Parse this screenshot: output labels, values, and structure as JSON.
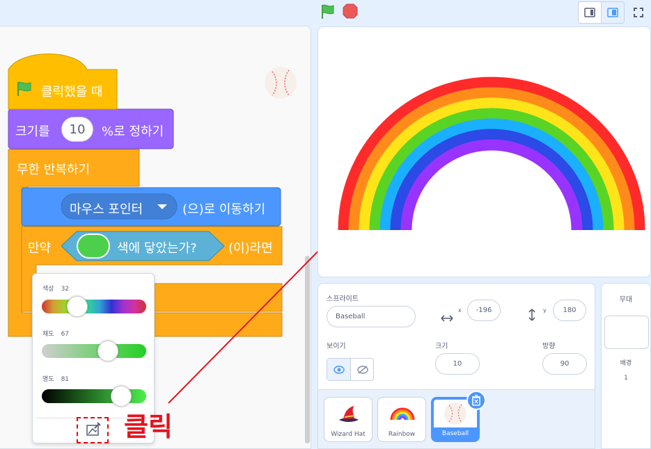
{
  "colors": {
    "events": "#ffbf00",
    "looks": "#9966ff",
    "control": "#ffab19",
    "motion": "#4c97ff",
    "sensing": "#5cb1d6",
    "accent": "#4c97ff",
    "annotation": "#e4131e"
  },
  "topbar": {
    "flag_icon": "green-flag-icon",
    "stop_icon": "stop-icon",
    "small_stage_icon": "small-stage-icon",
    "large_stage_icon": "large-stage-icon",
    "fullscreen_icon": "fullscreen-icon"
  },
  "script": {
    "hat_label": "클릭했을 때",
    "size_label_pre": "크기를",
    "size_value": "10",
    "size_label_post": "%로 정하기",
    "forever_label": "무한 반복하기",
    "goto_target": "마우스 포인터",
    "goto_label": "(으)로 이동하기",
    "if_label": "만약",
    "touching_label": "색에 닿았는가?",
    "then_label": "(이)라면",
    "touching_color": "#4cd04c"
  },
  "color_picker": {
    "hue_label": "색상",
    "hue_value": "32",
    "saturation_label": "채도",
    "saturation_value": "67",
    "brightness_label": "명도",
    "brightness_value": "81",
    "eyedropper_icon": "eyedropper-icon"
  },
  "annotation": {
    "click_label": "클릭"
  },
  "stage": {
    "rainbow_colors": [
      "#ff2a2a",
      "#ff8c1a",
      "#ffe41a",
      "#59d424",
      "#1ab0ff",
      "#2b4ae6",
      "#9933ff"
    ]
  },
  "sprite_info": {
    "sprite_label": "스프라이트",
    "sprite_name": "Baseball",
    "x_label": "x",
    "x_value": "-196",
    "y_label": "y",
    "y_value": "180",
    "show_label": "보이기",
    "size_label": "크기",
    "size_value": "10",
    "direction_label": "방향",
    "direction_value": "90"
  },
  "sprites": [
    {
      "name": "Wizard Hat",
      "selected": false
    },
    {
      "name": "Rainbow",
      "selected": false
    },
    {
      "name": "Baseball",
      "selected": true
    }
  ],
  "stage_panel": {
    "title": "무대",
    "backdrop_label": "배경",
    "backdrop_count": "1"
  }
}
